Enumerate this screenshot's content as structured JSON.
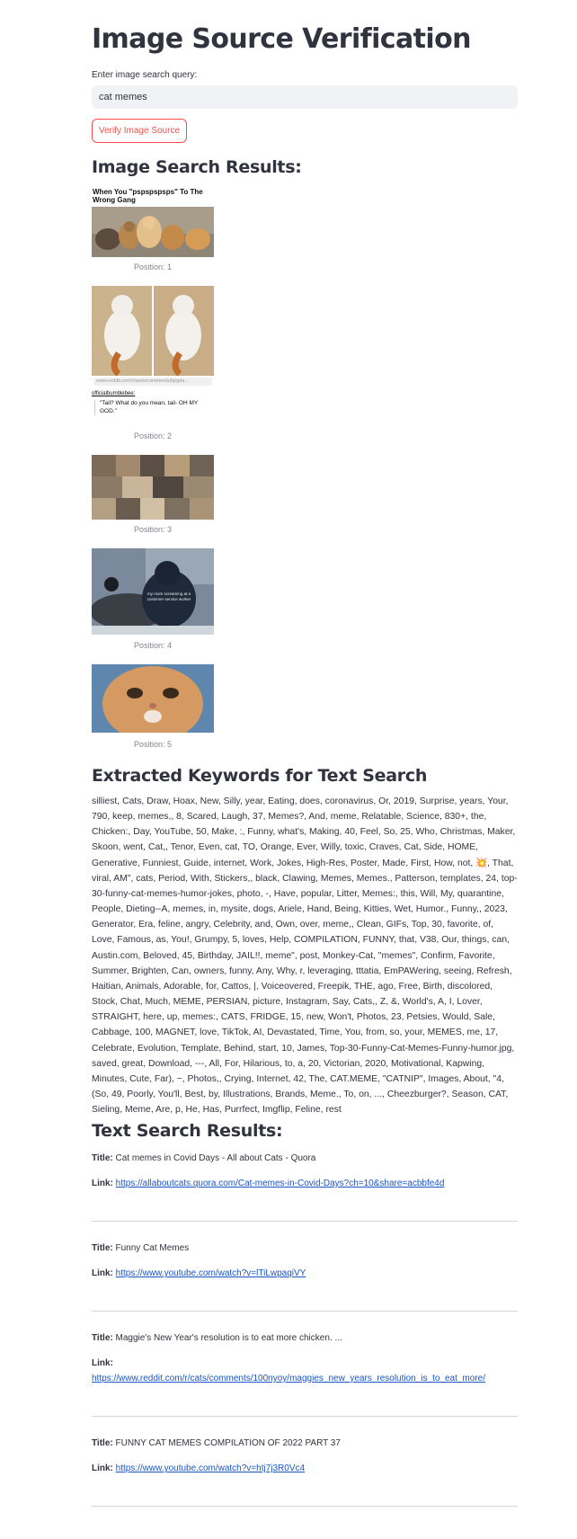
{
  "page": {
    "title": "Image Source Verification",
    "query_label": "Enter image search query:",
    "query_value": "cat memes",
    "verify_button": "Verify Image Source"
  },
  "image_results": {
    "heading": "Image Search Results:",
    "items": [
      {
        "position_label": "Position: 1",
        "meme_caption": "When You \"pspspspsps\" To The Wrong Gang"
      },
      {
        "position_label": "Position: 2",
        "url_text": "www.reddit.com/r/aww/comments/bjrgda...",
        "author": "officialbumblebee:",
        "quote": "\"Tail? What do you mean, tail- OH MY GOD.\""
      },
      {
        "position_label": "Position: 3"
      },
      {
        "position_label": "Position: 4",
        "overlay_text": "my mom screaming at a customer service worker"
      },
      {
        "position_label": "Position: 5"
      }
    ]
  },
  "keywords": {
    "heading": "Extracted Keywords for Text Search",
    "text": "silliest, Cats, Draw, Hoax, New, Silly, year, Eating, does, coronavirus, Or, 2019, Surprise, years, Your, 790, keep, memes,, 8, Scared, Laugh, 37, Memes?, And, meme, Relatable, Science, 830+, the, Chicken:, Day, YouTube, 50, Make, :, Funny, what's, Making, 40, Feel, So, 25, Who, Christmas, Maker, Skoon, went, Cat,, Tenor, Even, cat, TO, Orange, Ever, Willy, toxic, Craves, Cat, Side, HOME, Generative, Funniest, Guide, internet, Work, Jokes, High-Res, Poster, Made, First, How, not, 💥, That, viral, AM\", cats, Period, With, Stickers,, black, Clawing, Memes, Memes., Patterson, templates, 24, top-30-funny-cat-memes-humor-jokes, photo, -, Have, popular, Litter, Memes:, this, Will, My, quarantine, People, Dieting--A, memes, in, mysite, dogs, Ariele, Hand, Being, Kitties, Wet, Humor., Funny,, 2023, Generator, Era, feline, angry, Celebrity, and, Own, over, meme,, Clean, GIFs, Top, 30, favorite, of, Love, Famous, as, You!, Grumpy, 5, loves, Help, COMPILATION, FUNNY, that, V38, Our, things, can, Austin.com, Beloved, 45, Birthday, JAIL!!, meme\", post, Monkey-Cat, \"memes\", Confirm, Favorite, Summer, Brighten, Can, owners, funny, Any, Why, r, leveraging, tttatia, EmPAWering, seeing, Refresh, Haitian, Animals, Adorable, for, Cattos, |, Voiceovered, Freepik, THE, ago, Free, Birth, discolored, Stock, Chat, Much, MEME, PERSIAN, picture, Instagram, Say, Cats,, Z, &, World's, A, I, Lover, STRAIGHT, here, up, memes:, CATS, FRIDGE, 15, new, Won't, Photos, 23, Petsies, Would, Sale, Cabbage, 100, MAGNET, love, TikTok, AI, Devastated, Time, You, from, so, your, MEMES, me, 17, Celebrate, Evolution, Template, Behind, start, 10, James, Top-30-Funny-Cat-Memes-Funny-humor.jpg, saved, great, Download, ---, All, For, Hilarious, to, a, 20, Victorian, 2020, Motivational, Kapwing, Minutes, Cute, Far), ~, Photos,, Crying, Internet, 42, The, CAT.MEME, \"CATNIP\", Images, About, \"4, (So, 49, Poorly, You'll, Best, by, Illustrations, Brands, Meme., To, on, ..., Cheezburger?, Season, CAT, Sieling, Meme, Are, p, He, Has, Purrfect, Imgflip, Feline, rest"
  },
  "text_results": {
    "heading": "Text Search Results:",
    "title_label": "Title:",
    "link_label": "Link:",
    "r0": {
      "title": "Cat memes in Covid Days - All about Cats - Quora",
      "link": "https://allaboutcats.quora.com/Cat-memes-in-Covid-Days?ch=10&share=acbbfe4d"
    },
    "r1": {
      "title": "Funny Cat Memes",
      "link": "https://www.youtube.com/watch?v=lTiLwpaqiVY"
    },
    "r2": {
      "title": "Maggie's New Year's resolution is to eat more chicken. ...",
      "link": "https://www.reddit.com/r/cats/comments/100nyoy/maggies_new_years_resolution_is_to_eat_more/"
    },
    "r3": {
      "title": "FUNNY CAT MEMES COMPILATION OF 2022 PART 37",
      "link": "https://www.youtube.com/watch?v=htj7j3R0Vc4"
    }
  }
}
